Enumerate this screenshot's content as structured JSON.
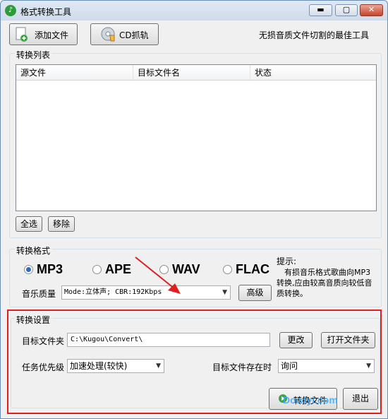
{
  "window": {
    "title": "格式转换工具",
    "buttons": {
      "minimize": "▬",
      "maximize": "▢",
      "close": "✕"
    }
  },
  "toolbar": {
    "add_file_label": "添加文件",
    "cd_rip_label": "CD抓轨",
    "slogan": "无损音质文件切割的最佳工具"
  },
  "convert_list": {
    "group_label": "转换列表",
    "columns": [
      "源文件",
      "目标文件名",
      "状态"
    ],
    "rows": [],
    "select_all_label": "全选",
    "remove_label": "移除"
  },
  "format": {
    "group_label": "转换格式",
    "options": [
      "MP3",
      "APE",
      "WAV",
      "FLAC"
    ],
    "selected": "MP3",
    "quality_label": "音乐质量",
    "quality_value": "Mode:立体声; CBR:192Kbps",
    "advanced_label": "高级",
    "tip_title": "提示:",
    "tip_text": "有损音乐格式歌曲向MP3转换,应由较高音质向较低音质转换。"
  },
  "settings": {
    "group_label": "转换设置",
    "target_folder_label": "目标文件夹",
    "target_folder_value": "C:\\Kugou\\Convert\\",
    "change_label": "更改",
    "open_folder_label": "打开文件夹",
    "priority_label": "任务优先级",
    "priority_value": "加速处理(较快)",
    "exists_label": "目标文件存在时",
    "exists_value": "询问",
    "convert_label": "转换文件",
    "exit_label": "退出"
  },
  "watermark": "Dowlyi.com",
  "colors": {
    "highlight": "#e02020",
    "arrow": "#e02020",
    "radio_selected": "#2c6cc3"
  }
}
